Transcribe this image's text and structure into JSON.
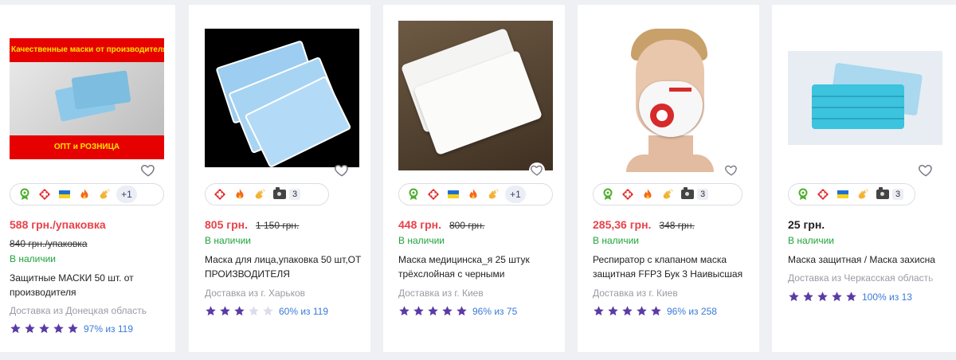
{
  "colors": {
    "price_red": "#e8424a",
    "available_green": "#1fa33a",
    "star_purple": "#5b3aa6",
    "star_empty": "#dcdcec",
    "link_blue": "#3a7ad6",
    "background": "#eef0f3"
  },
  "cards": [
    {
      "image_banner_top": "Качественные маски от производителя",
      "image_banner_bottom": "ОПТ и РОЗНИЦА",
      "badges": [
        "medal-icon",
        "pharmacy-cross-icon",
        "ukraine-flag-icon",
        "fire-icon",
        "clapping-hands-icon"
      ],
      "more": "+1",
      "price": "588 грн./упаковка",
      "old_price": "840 грн./упаковка",
      "availability": "В наличии",
      "title": "Защитные МАСКИ 50 шт. от производителя",
      "shipping": "Доставка из Донецкая область",
      "stars_filled": 5,
      "rating_text": "97% из 119"
    },
    {
      "badges": [
        "pharmacy-cross-icon",
        "fire-icon",
        "clapping-hands-icon"
      ],
      "photos_count": "3",
      "price": "805 грн.",
      "old_price": "1 150 грн.",
      "availability": "В наличии",
      "title": "Маска для лица,упаковка 50 шт,ОТ ПРОИЗВОДИТЕЛЯ",
      "shipping": "Доставка из г. Харьков",
      "stars_filled": 3,
      "rating_text": "60% из 119"
    },
    {
      "badges": [
        "medal-icon",
        "pharmacy-cross-icon",
        "ukraine-flag-icon",
        "fire-icon",
        "clapping-hands-icon"
      ],
      "more": "+1",
      "price": "448 грн.",
      "old_price": "800 грн.",
      "availability": "В наличии",
      "title": "Маска медицинска_я 25 штук трёхслойная с черными",
      "shipping": "Доставка из г. Киев",
      "stars_filled": 5,
      "rating_text": "96% из 75"
    },
    {
      "badges": [
        "medal-icon",
        "pharmacy-cross-icon",
        "fire-icon",
        "clapping-hands-icon"
      ],
      "photos_count": "3",
      "price": "285,36 грн.",
      "old_price": "348 грн.",
      "availability": "В наличии",
      "title": "Респиратор с клапаном маска защитная FFP3 Бук 3 Наивысшая",
      "shipping": "Доставка из г. Киев",
      "stars_filled": 5,
      "rating_text": "96% из 258"
    },
    {
      "badges": [
        "medal-icon",
        "pharmacy-cross-icon",
        "ukraine-flag-icon",
        "clapping-hands-icon"
      ],
      "photos_count": "3",
      "price": "25 грн.",
      "availability": "В наличии",
      "title": "Маска защитная / Маска захисна",
      "shipping": "Доставка из Черкасская область",
      "stars_filled": 5,
      "rating_text": "100% из 13"
    }
  ]
}
